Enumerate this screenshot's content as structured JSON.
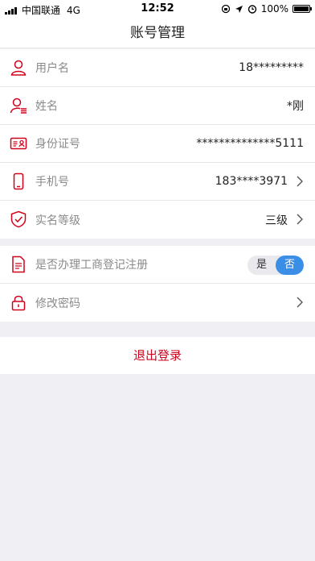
{
  "status_bar": {
    "carrier": "中国联通",
    "network": "4G",
    "time": "12:52",
    "battery": "100%"
  },
  "nav": {
    "title": "账号管理"
  },
  "profile_rows": [
    {
      "label": "用户名",
      "value": "18*********",
      "icon": "user-icon"
    },
    {
      "label": "姓名",
      "value": "*刚",
      "icon": "user-list-icon"
    },
    {
      "label": "身份证号",
      "value": "**************5111",
      "icon": "id-card-icon"
    },
    {
      "label": "手机号",
      "value": "183****3971",
      "icon": "phone-icon"
    },
    {
      "label": "实名等级",
      "value": "三级",
      "icon": "shield-check-icon"
    }
  ],
  "settings_rows": [
    {
      "label": "是否办理工商登记注册",
      "icon": "document-icon",
      "toggle": {
        "yes": "是",
        "no": "否",
        "selected": "否"
      }
    },
    {
      "label": "修改密码",
      "icon": "lock-icon"
    }
  ],
  "logout_label": "退出登录",
  "colors": {
    "accent": "#d0021b",
    "toggle_active": "#3a8ee6",
    "background": "#efeff4"
  }
}
